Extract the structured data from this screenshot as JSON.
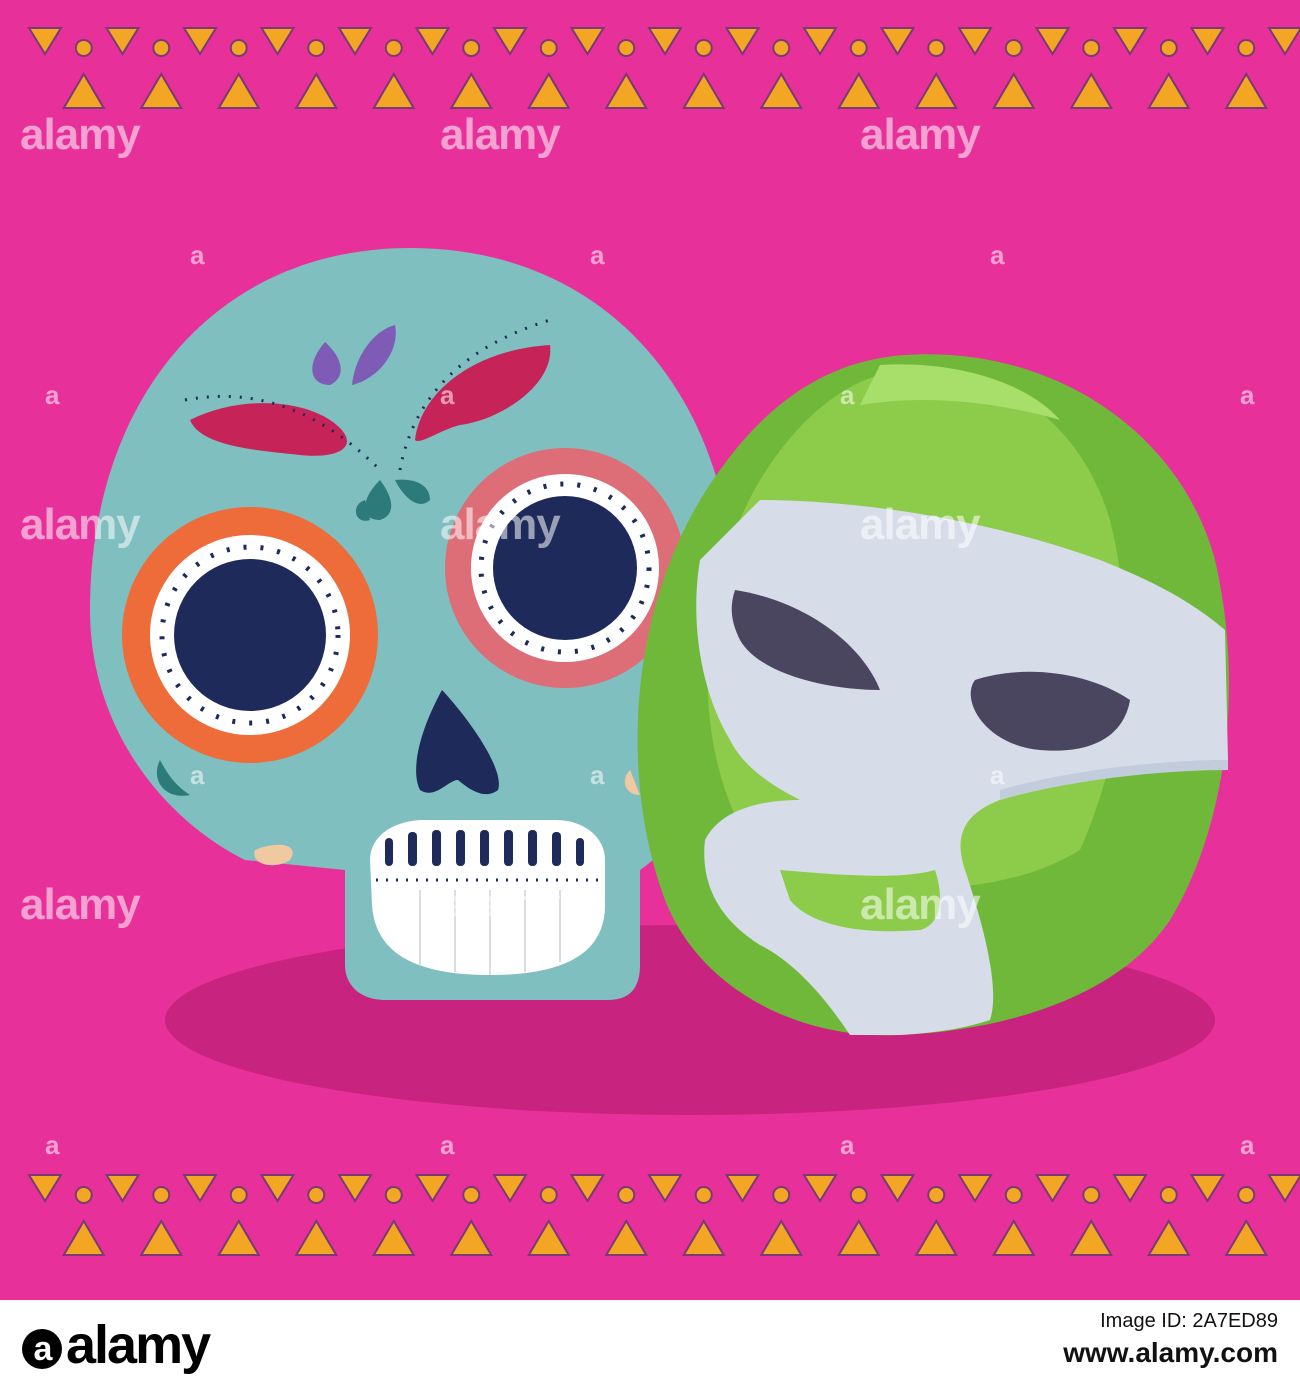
{
  "colors": {
    "background": "#e8309a",
    "border_yellow": "#f2a623",
    "border_dots": "#7a3a73",
    "skull": "#7fbfc0",
    "mask_green": "#8ccc4a",
    "mask_white": "#d6dce8",
    "shadow": "#c8237e",
    "eye_navy": "#1e2a5a"
  },
  "icons": [
    "sugar-skull-icon",
    "luchador-mask-icon"
  ],
  "watermark": {
    "text": "alamy",
    "small_text": "a"
  },
  "footer": {
    "logo_mark": "a",
    "logo_text": "alamy",
    "image_id": "Image ID: 2A7ED89",
    "url": "www.alamy.com"
  }
}
